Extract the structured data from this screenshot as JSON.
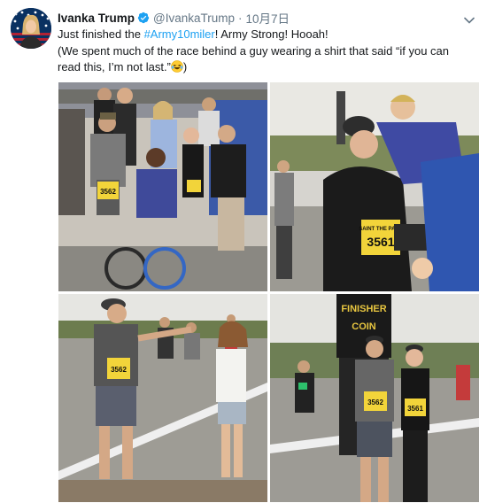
{
  "tweet": {
    "author_name": "Ivanka Trump",
    "handle": "@IvankaTrump",
    "separator": "·",
    "timestamp": "10月7日",
    "text_before_hashtag": "Just finished the ",
    "hashtag": "#Army10miler",
    "text_after_hashtag": "! Army Strong! Hooah!",
    "text_line2": "(We spent much of the race behind a guy wearing a shirt that said “if you can read this, I’m not last.”",
    "text_line2_end": ")"
  },
  "photos": {
    "bib_3562": "3562",
    "bib_3561": "3561",
    "shirt_top": "SAINT THE PACE",
    "banner_line1": "FINISHER",
    "banner_line2": "COIN"
  },
  "colors": {
    "hashtag": "#1da1f2",
    "verified": "#1da1f2",
    "meta_text": "#657786",
    "bib_yellow": "#f2d43a"
  },
  "icons": {
    "verified": "verified-badge-icon",
    "caret": "chevron-down-icon",
    "emoji": "laughing-crying-emoji"
  }
}
